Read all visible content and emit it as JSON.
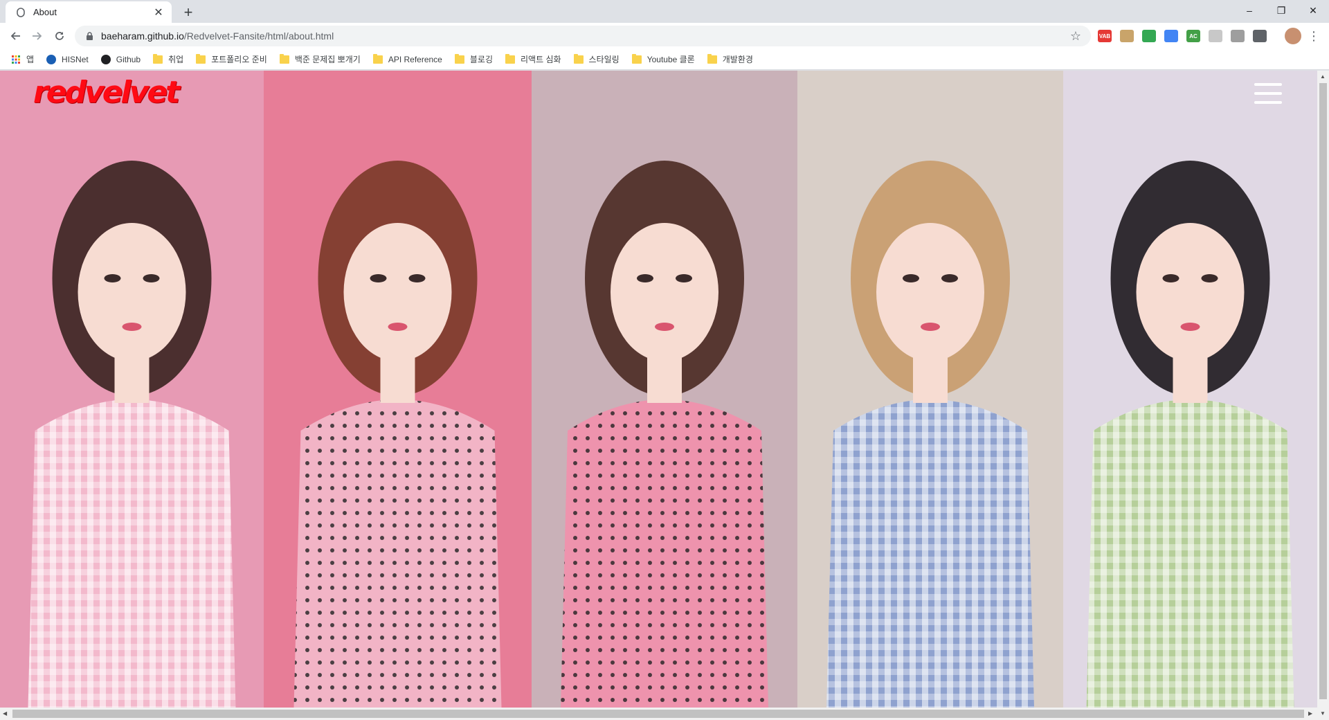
{
  "browser": {
    "tab": {
      "title": "About",
      "favicon": "page-icon"
    },
    "new_tab_label": "+",
    "window_controls": {
      "minimize": "–",
      "restore": "❐",
      "close": "✕"
    },
    "address": {
      "host": "baeharam.github.io",
      "path": "/Redvelvet-Fansite/html/about.html"
    },
    "bookmarks": [
      {
        "label": "앱",
        "icon": "apps-grid-icon"
      },
      {
        "label": "HISNet",
        "icon": "hisnet-icon"
      },
      {
        "label": "Github",
        "icon": "github-icon"
      },
      {
        "label": "취업",
        "icon": "folder-icon"
      },
      {
        "label": "포트폴리오 준비",
        "icon": "folder-icon"
      },
      {
        "label": "백준 문제집 뽀개기",
        "icon": "folder-icon"
      },
      {
        "label": "API Reference",
        "icon": "folder-icon"
      },
      {
        "label": "블로깅",
        "icon": "folder-icon"
      },
      {
        "label": "리액트 심화",
        "icon": "folder-icon"
      },
      {
        "label": "스타일링",
        "icon": "folder-icon"
      },
      {
        "label": "Youtube 클론",
        "icon": "folder-icon"
      },
      {
        "label": "개발환경",
        "icon": "folder-icon"
      }
    ],
    "extensions": [
      {
        "name": "vab-extension-icon",
        "label": "VAB",
        "color": "#e53935"
      },
      {
        "name": "ext-box-icon",
        "label": "",
        "color": "#c9a46a"
      },
      {
        "name": "shield-extension-icon",
        "label": "",
        "color": "#34a853"
      },
      {
        "name": "pen-extension-icon",
        "label": "",
        "color": "#4285f4"
      },
      {
        "name": "ac-extension-icon",
        "label": "AC",
        "color": "#43a047"
      },
      {
        "name": "gray-extension-icon",
        "label": "",
        "color": "#c8c8c8"
      },
      {
        "name": "clock-extension-icon",
        "label": "",
        "color": "#9e9e9e"
      },
      {
        "name": "info-extension-icon",
        "label": "",
        "color": "#5f6368"
      }
    ]
  },
  "page": {
    "logo_text": "redvelvet",
    "menu_icon": "hamburger-menu-icon",
    "members": [
      {
        "name": "member-panel-irene",
        "bg": "#e79ab4",
        "dress": "#f3b9cc",
        "accent": "#3a2420"
      },
      {
        "name": "member-panel-seulgi",
        "bg": "#e77d97",
        "dress": "#f2b4c6",
        "accent": "#7a3a28"
      },
      {
        "name": "member-panel-wendy",
        "bg": "#c9b1b8",
        "dress": "#ee93ad",
        "accent": "#4a2a22"
      },
      {
        "name": "member-panel-yeri",
        "bg": "#d9cfc8",
        "dress": "#8fa2cf",
        "accent": "#c89b6c"
      },
      {
        "name": "member-panel-joy",
        "bg": "#e0d8e4",
        "dress": "#b6cf9a",
        "accent": "#1e1a1e"
      }
    ]
  }
}
